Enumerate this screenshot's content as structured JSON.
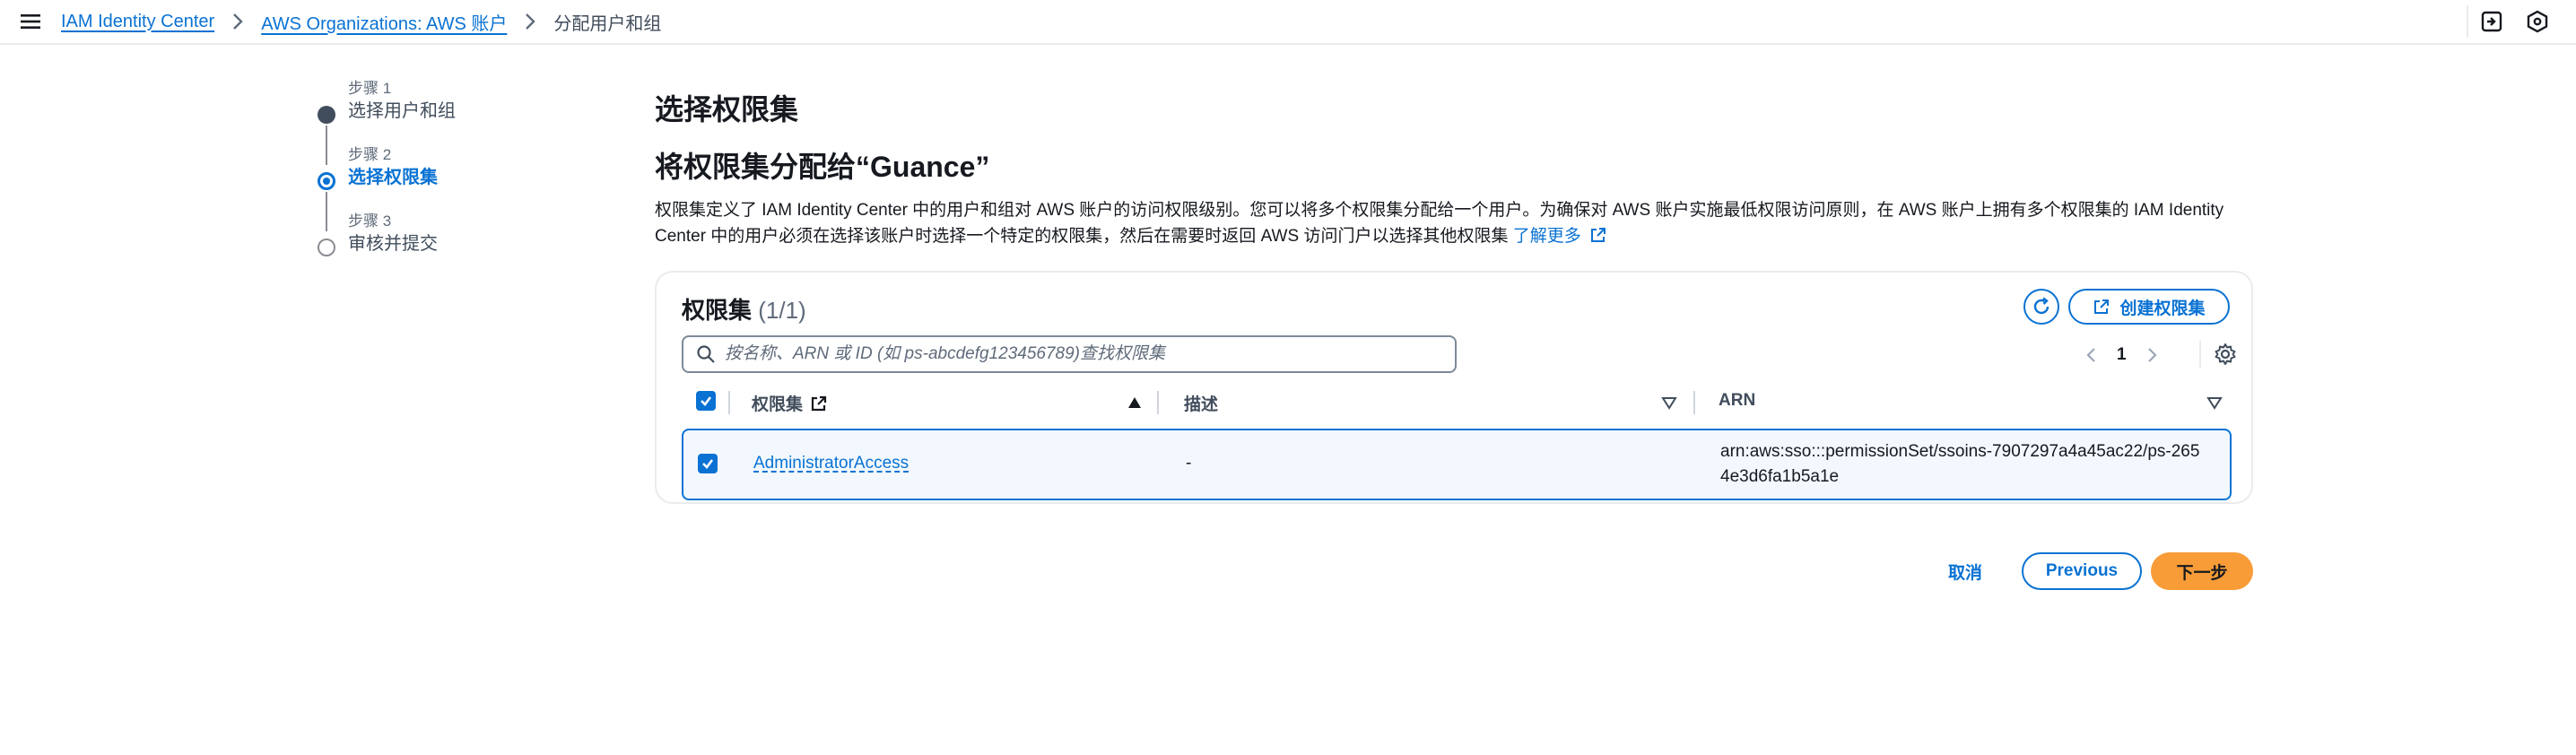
{
  "breadcrumbs": {
    "items": [
      {
        "label": "IAM Identity Center"
      },
      {
        "label": "AWS Organizations: AWS 账户"
      }
    ],
    "current": "分配用户和组"
  },
  "steps": [
    {
      "label": "步骤 1",
      "title": "选择用户和组",
      "state": "done"
    },
    {
      "label": "步骤 2",
      "title": "选择权限集",
      "state": "active"
    },
    {
      "label": "步骤 3",
      "title": "审核并提交",
      "state": "pending"
    }
  ],
  "page": {
    "title": "选择权限集",
    "subtitle": "将权限集分配给“Guance”",
    "description": "权限集定义了 IAM Identity Center 中的用户和组对 AWS 账户的访问权限级别。您可以将多个权限集分配给一个用户。为确保对 AWS 账户实施最低权限访问原则，在 AWS 账户上拥有多个权限集的 IAM Identity Center 中的用户必须在选择该账户时选择一个特定的权限集，然后在需要时返回 AWS 访问门户以选择其他权限集",
    "learn_more": "了解更多"
  },
  "panel": {
    "title": "权限集",
    "count": "(1/1)",
    "create_label": "创建权限集",
    "search_placeholder": "按名称、ARN 或 ID (如 ps-abcdefg123456789)查找权限集",
    "page_number": "1",
    "columns": {
      "name": "权限集",
      "description": "描述",
      "arn": "ARN"
    },
    "rows": [
      {
        "name": "AdministratorAccess",
        "description": "-",
        "arn": "arn:aws:sso:::permissionSet/ssoins-7907297a4a45ac22/ps-2654e3d6fa1b5a1e",
        "selected": true
      }
    ]
  },
  "footer": {
    "cancel": "取消",
    "previous": "Previous",
    "next": "下一步"
  },
  "colors": {
    "accent": "#0972d3",
    "primary_button": "#f89c37",
    "text": "#16191f",
    "border": "#e9ebed"
  }
}
